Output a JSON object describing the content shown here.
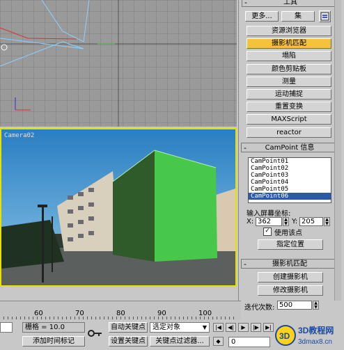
{
  "panel": {
    "tools_title": "工具",
    "more_label": "更多...",
    "set_label": "集",
    "tools": [
      {
        "label": "资源浏览器",
        "active": false
      },
      {
        "label": "摄影机匹配",
        "active": true
      },
      {
        "label": "塌陷",
        "active": false
      },
      {
        "label": "颜色剪贴板",
        "active": false
      },
      {
        "label": "测量",
        "active": false
      },
      {
        "label": "运动捕捉",
        "active": false
      },
      {
        "label": "重置变换",
        "active": false
      },
      {
        "label": "MAXScript",
        "active": false
      },
      {
        "label": "reactor",
        "active": false
      }
    ],
    "campoint_title": "CamPoint 信息",
    "campoints": [
      "CamPoint01",
      "CamPoint02",
      "CamPoint03",
      "CamPoint04",
      "CamPoint05",
      "CamPoint06"
    ],
    "selected_campoint": "CamPoint06",
    "input_coords_label": "输入屏幕坐标:",
    "x_label": "X:",
    "x_value": "362",
    "y_label": "Y:",
    "y_value": "205",
    "use_point_label": "使用该点",
    "use_point_checked": true,
    "assign_position_label": "指定位置",
    "camera_match_title": "摄影机匹配",
    "create_camera_label": "创建摄影机",
    "modify_camera_label": "修改摄影机",
    "iterations_label": "迭代次数:",
    "iterations_value": "500",
    "collapse_sign": "-"
  },
  "viewport": {
    "camera_label": "Camera02"
  },
  "timeline": {
    "ticks": [
      "60",
      "70",
      "80",
      "90",
      "100"
    ]
  },
  "bottom": {
    "grid_label": "栅格 = 10.0",
    "add_time_tag_label": "添加时间标记",
    "auto_key_label": "自动关键点",
    "set_key_label": "设置关键点",
    "selected_object_label": "选定对象",
    "key_filter_label": "关键点过滤器...",
    "frame_value": "0"
  },
  "watermark": {
    "brand": "3D教程网",
    "url": "3dmax8.cn"
  },
  "colors": {
    "active_button": "#f4c23c",
    "list_selection": "#2a5aa8",
    "building_face": "#2f5a2a",
    "building_side": "#47c84a",
    "camera_border": "#e8e000"
  }
}
